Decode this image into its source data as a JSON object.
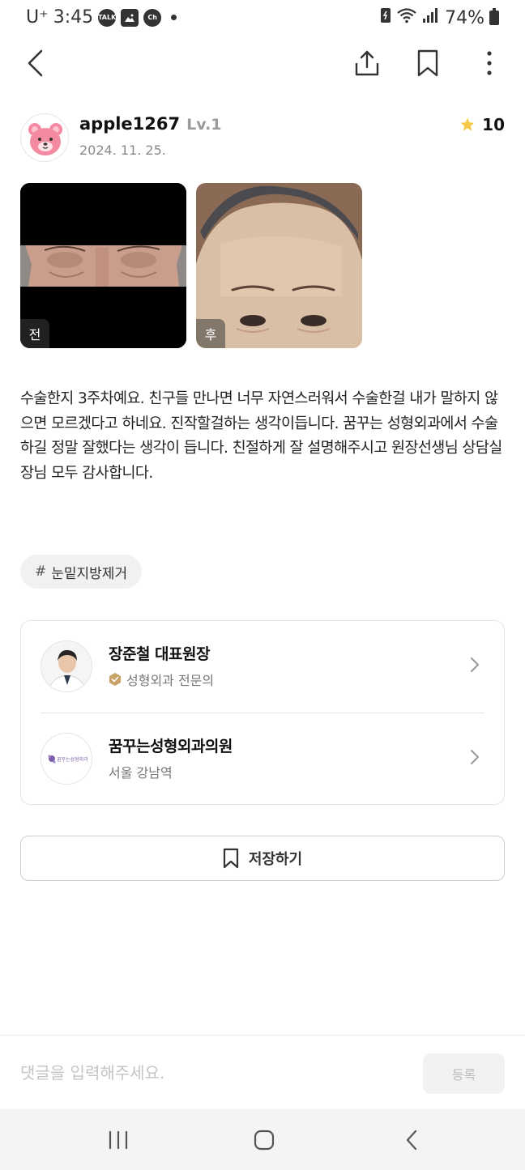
{
  "status_bar": {
    "carrier": "U⁺",
    "time": "3:45",
    "battery": "74%",
    "notifications": [
      "talk-icon",
      "gallery-icon",
      "channel-icon"
    ]
  },
  "top_bar": {
    "icons": [
      "back-arrow-icon",
      "share-icon",
      "bookmark-icon",
      "more-vertical-icon"
    ]
  },
  "author": {
    "name": "apple1267",
    "level": "Lv.1",
    "date": "2024. 11. 25.",
    "rating": "10",
    "avatar_icon": "pink-bear-icon"
  },
  "photos": [
    {
      "tag": "전"
    },
    {
      "tag": "후"
    }
  ],
  "review": {
    "text": "수술한지 3주차예요. 친구들 만나면 너무 자연스러워서 수술한걸 내가 말하지 않으면 모르겠다고 하네요. 진작할걸하는 생각이듭니다. 꿈꾸는 성형외과에서 수술하길 정말 잘했다는 생각이 듭니다. 친절하게 잘 설명해주시고 원장선생님 상담실장님 모두 감사합니다."
  },
  "tag": {
    "hash": "#",
    "label": "눈밑지방제거"
  },
  "doctor": {
    "name": "장준철 대표원장",
    "specialty": "성형외과 전문의"
  },
  "clinic": {
    "name": "꿈꾸는성형외과의원",
    "location": "서울 강남역",
    "logo_text": "꿈꾸는성형외과"
  },
  "save_button": {
    "label": "저장하기"
  },
  "comment": {
    "placeholder": "댓글을 입력해주세요.",
    "submit_label": "등록"
  },
  "colors": {
    "star": "#f7c948",
    "badge": "#c8a165",
    "muted": "#8a8a8a",
    "card_border": "#e4e4e4"
  }
}
